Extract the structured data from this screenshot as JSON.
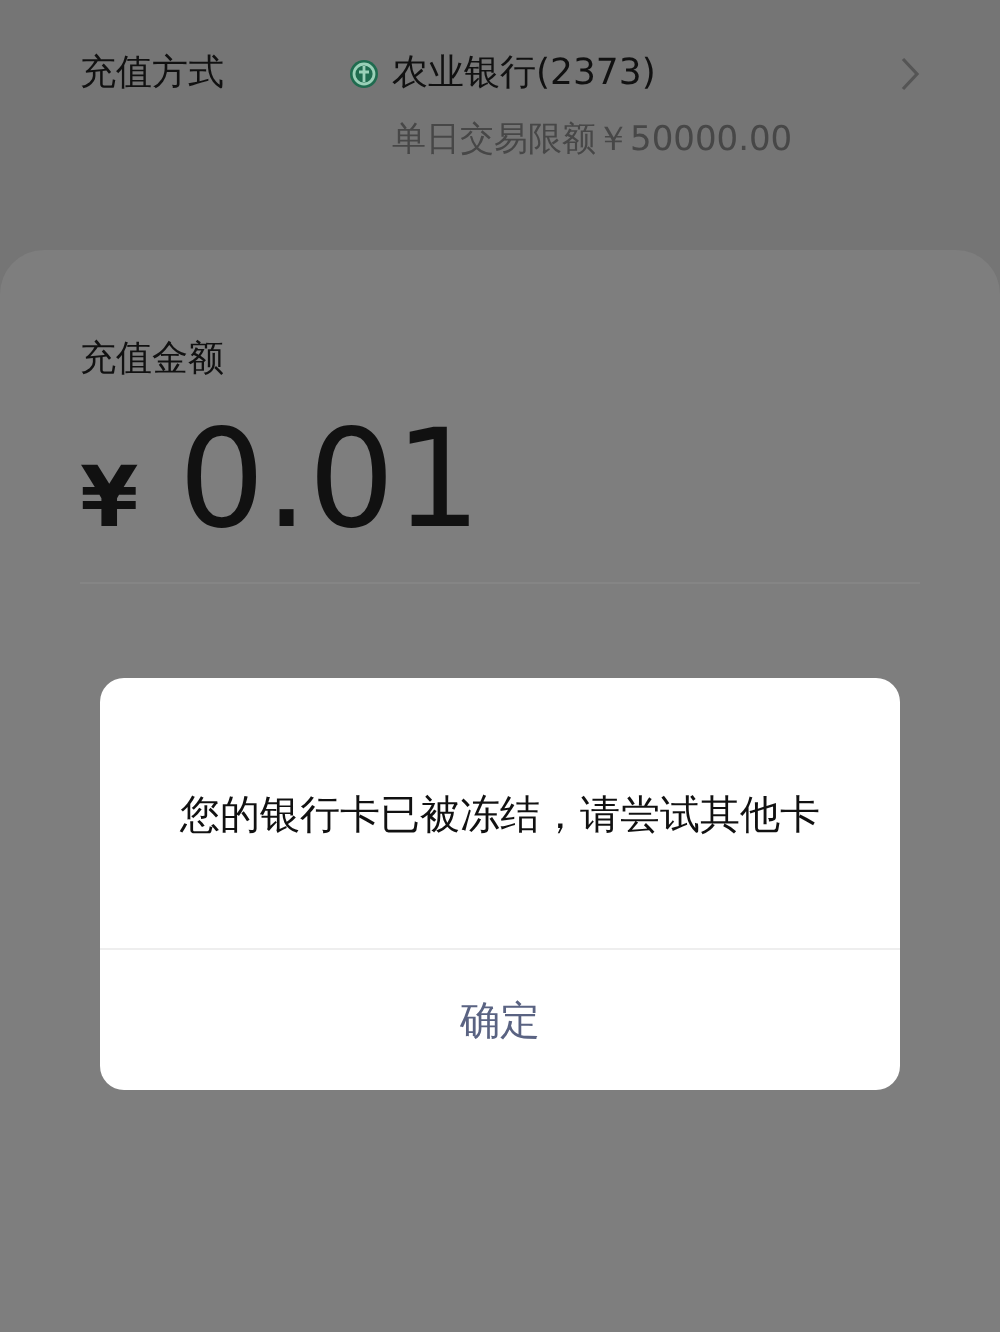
{
  "payment_method": {
    "label": "充值方式",
    "bank_name": "农业银行(2373)",
    "daily_limit": "单日交易限额￥50000.00"
  },
  "amount": {
    "label": "充值金额",
    "currency": "¥",
    "value": "0.01"
  },
  "dialog": {
    "message": "您的银行卡已被冻结，请尝试其他卡",
    "buttons": [
      "确定"
    ]
  }
}
